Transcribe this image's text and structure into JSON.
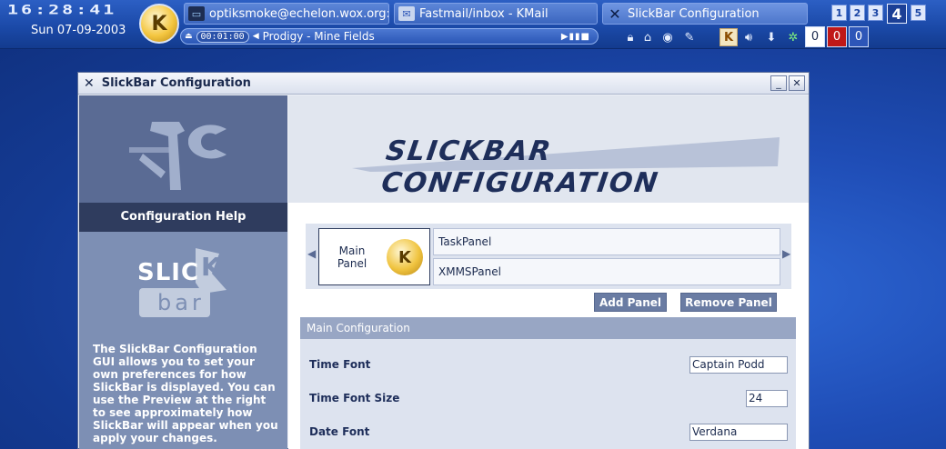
{
  "topbar": {
    "clock_time": "16:28:41",
    "date": "Sun 07-09-2003",
    "kmenu_label": "K",
    "tasks": [
      {
        "label": "optiksmoke@echelon.wox.org: /l",
        "icon": "terminal-icon"
      },
      {
        "label": "Fastmail/inbox - KMail",
        "icon": "kmail-icon"
      },
      {
        "label": "SlickBar Configuration",
        "icon": "x-icon"
      }
    ],
    "desktops": [
      "1",
      "2",
      "3",
      "4",
      "5"
    ],
    "current_desktop": "4",
    "player": {
      "time": "00:01:00",
      "track": "Prodigy - Mine Fields"
    },
    "counters": [
      "0",
      "0",
      "0"
    ],
    "counter_colors": [
      "#ffffff",
      "#c01818",
      "#2d56b8"
    ]
  },
  "window": {
    "title": "SlickBar Configuration",
    "sidebar": {
      "help_header": "Configuration Help",
      "logo_top": "SLIC",
      "logo_k": "K",
      "logo_bottom": "bar",
      "help_text": "The SlickBar Configuration GUI allows you to set your own preferences for how SlickBar is displayed. You can use the Preview at the right to see approximately how SlickBar will appear when you apply your changes."
    },
    "banner_title": "SLICKBAR CONFIGURATION",
    "preview": {
      "main_panel_label": "Main Panel",
      "panels": [
        "TaskPanel",
        "XMMSPanel"
      ]
    },
    "buttons": {
      "add_panel": "Add Panel",
      "remove_panel": "Remove Panel"
    },
    "main_config": {
      "heading": "Main Configuration",
      "fields": [
        {
          "label": "Time Font",
          "value": "Captain Podd"
        },
        {
          "label": "Time Font Size",
          "value": "24"
        },
        {
          "label": "Date Font",
          "value": "Verdana"
        }
      ]
    }
  }
}
